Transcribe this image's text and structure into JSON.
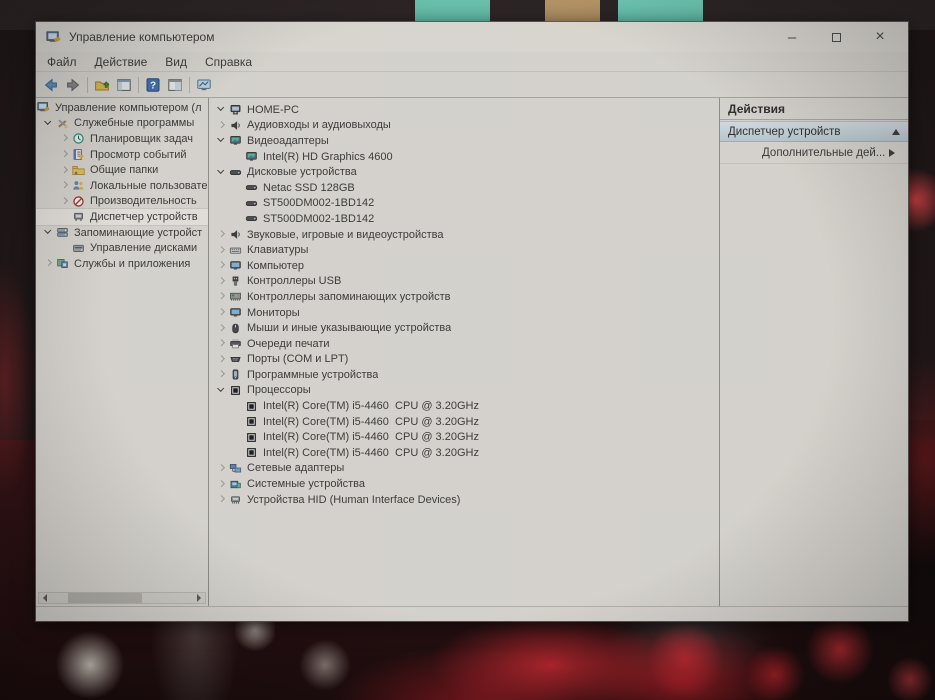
{
  "titlebar": {
    "title": "Управление компьютером"
  },
  "controls": {
    "minimize_glyph": "–",
    "close_glyph": "×"
  },
  "menu": {
    "items": [
      "Файл",
      "Действие",
      "Вид",
      "Справка"
    ]
  },
  "toolbar": {
    "buttons": [
      {
        "icon": "back-icon"
      },
      {
        "icon": "forward-icon"
      },
      {
        "icon": "separator"
      },
      {
        "icon": "up-folder-icon"
      },
      {
        "icon": "console-window-icon"
      },
      {
        "icon": "separator"
      },
      {
        "icon": "help-icon"
      },
      {
        "icon": "properties-window-icon"
      },
      {
        "icon": "separator"
      },
      {
        "icon": "console-display-icon"
      }
    ]
  },
  "left_tree": {
    "items": [
      {
        "label": "Управление компьютером (л",
        "icon": "computer-mgmt",
        "indent": 0,
        "state": "root"
      },
      {
        "label": "Служебные программы",
        "icon": "tools",
        "indent": 1,
        "state": "exp"
      },
      {
        "label": "Планировщик задач",
        "icon": "clock",
        "indent": 2,
        "state": "col"
      },
      {
        "label": "Просмотр событий",
        "icon": "eventlog",
        "indent": 2,
        "state": "col"
      },
      {
        "label": "Общие папки",
        "icon": "folder-shared",
        "indent": 2,
        "state": "col"
      },
      {
        "label": "Локальные пользовате",
        "icon": "users",
        "indent": 2,
        "state": "col"
      },
      {
        "label": "Производительность",
        "icon": "perf",
        "indent": 2,
        "state": "col"
      },
      {
        "label": "Диспетчер устройств",
        "icon": "devmgr",
        "indent": 2,
        "state": "leaf",
        "selected": true
      },
      {
        "label": "Запоминающие устройст",
        "icon": "storage",
        "indent": 1,
        "state": "exp"
      },
      {
        "label": "Управление дисками",
        "icon": "diskmgmt",
        "indent": 2,
        "state": "leaf"
      },
      {
        "label": "Службы и приложения",
        "icon": "svcapp",
        "indent": 1,
        "state": "col"
      }
    ]
  },
  "device_tree": {
    "items": [
      {
        "label": "HOME-PC",
        "icon": "computer",
        "indent": 0,
        "state": "exp"
      },
      {
        "label": "Аудиовходы и аудиовыходы",
        "icon": "audio",
        "indent": 1,
        "state": "col"
      },
      {
        "label": "Видеоадаптеры",
        "icon": "display",
        "indent": 1,
        "state": "exp"
      },
      {
        "label": "Intel(R) HD Graphics 4600",
        "icon": "display",
        "indent": 2,
        "state": "leaf"
      },
      {
        "label": "Дисковые устройства",
        "icon": "disk",
        "indent": 1,
        "state": "exp"
      },
      {
        "label": "Netac SSD 128GB",
        "icon": "disk",
        "indent": 2,
        "state": "leaf"
      },
      {
        "label": "ST500DM002-1BD142",
        "icon": "disk",
        "indent": 2,
        "state": "leaf"
      },
      {
        "label": "ST500DM002-1BD142",
        "icon": "disk",
        "indent": 2,
        "state": "leaf"
      },
      {
        "label": "Звуковые, игровые и видеоустройства",
        "icon": "audio",
        "indent": 1,
        "state": "col"
      },
      {
        "label": "Клавиатуры",
        "icon": "keyboard",
        "indent": 1,
        "state": "col"
      },
      {
        "label": "Компьютер",
        "icon": "monitor",
        "indent": 1,
        "state": "col"
      },
      {
        "label": "Контроллеры USB",
        "icon": "usb",
        "indent": 1,
        "state": "col"
      },
      {
        "label": "Контроллеры запоминающих устройств",
        "icon": "storctrl",
        "indent": 1,
        "state": "col"
      },
      {
        "label": "Мониторы",
        "icon": "monitor",
        "indent": 1,
        "state": "col"
      },
      {
        "label": "Мыши и иные указывающие устройства",
        "icon": "mouse",
        "indent": 1,
        "state": "col"
      },
      {
        "label": "Очереди печати",
        "icon": "printer",
        "indent": 1,
        "state": "col"
      },
      {
        "label": "Порты (COM и LPT)",
        "icon": "ports",
        "indent": 1,
        "state": "col"
      },
      {
        "label": "Программные устройства",
        "icon": "softdev",
        "indent": 1,
        "state": "col"
      },
      {
        "label": "Процессоры",
        "icon": "cpu",
        "indent": 1,
        "state": "exp"
      },
      {
        "label": "Intel(R) Core(TM) i5-4460  CPU @ 3.20GHz",
        "icon": "cpu",
        "indent": 2,
        "state": "leaf"
      },
      {
        "label": "Intel(R) Core(TM) i5-4460  CPU @ 3.20GHz",
        "icon": "cpu",
        "indent": 2,
        "state": "leaf"
      },
      {
        "label": "Intel(R) Core(TM) i5-4460  CPU @ 3.20GHz",
        "icon": "cpu",
        "indent": 2,
        "state": "leaf"
      },
      {
        "label": "Intel(R) Core(TM) i5-4460  CPU @ 3.20GHz",
        "icon": "cpu",
        "indent": 2,
        "state": "leaf"
      },
      {
        "label": "Сетевые адаптеры",
        "icon": "network",
        "indent": 1,
        "state": "col"
      },
      {
        "label": "Системные устройства",
        "icon": "sysdev",
        "indent": 1,
        "state": "col"
      },
      {
        "label": "Устройства HID (Human Interface Devices)",
        "icon": "hid",
        "indent": 1,
        "state": "col"
      }
    ]
  },
  "actions": {
    "title": "Действия",
    "primary": {
      "label": "Диспетчер устройств"
    },
    "secondary": {
      "label": "Дополнительные дей..."
    }
  },
  "colors": {
    "pane_bg": "#d8d6d1",
    "selection_bar": "#c4d4df",
    "wallpaper_red": "#b5252f",
    "wallpaper_teal": "#6cc8b4"
  }
}
